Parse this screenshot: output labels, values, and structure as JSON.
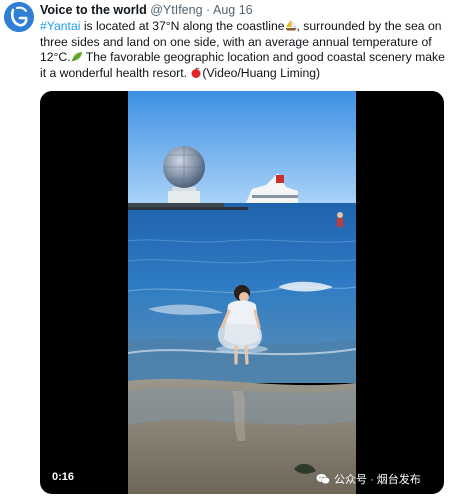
{
  "author": {
    "display_name": "Voice to the world",
    "handle": "@YtIfeng",
    "separator": "·",
    "date": "Aug 16"
  },
  "tweet": {
    "hashtag": "#Yantai",
    "part1": " is located at 37°N along the coastline",
    "part2": ", surrounded by the sea on three sides and land on one side, with an average annual temperature of 12°C.",
    "part3": " The favorable geographic location and good coastal scenery make it a wonderful health resort. ",
    "part4": "(Video/Huang Liming)"
  },
  "icons": {
    "avatar": "logo-avatar",
    "sailboat": "sailboat-emoji",
    "leaf": "leaf-emoji",
    "apple": "red-apple-emoji",
    "watermark": "wechat-icon"
  },
  "video": {
    "duration": "0:16",
    "watermark_text": "公众号 · 烟台发布"
  },
  "colors": {
    "link": "#1d9bf0",
    "secondary_text": "#536471",
    "sky": "#4a9be6",
    "sea": "#2a6fb3"
  }
}
